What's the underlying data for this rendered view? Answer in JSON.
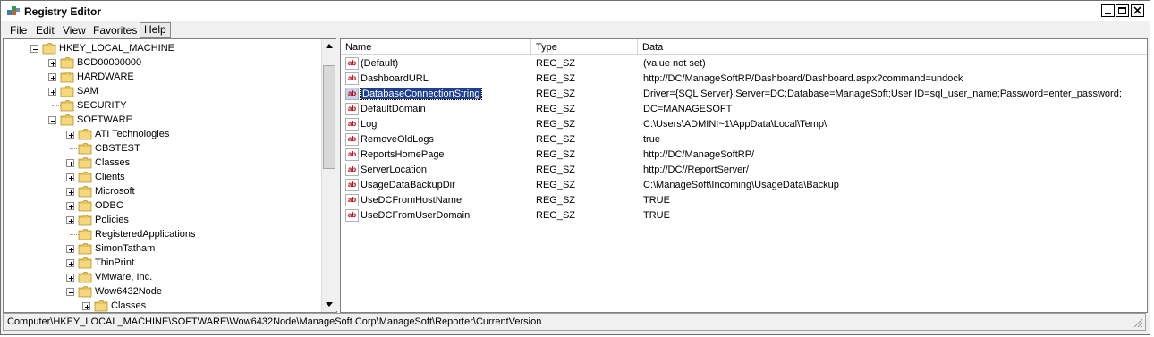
{
  "window": {
    "title": "Registry Editor"
  },
  "menu": [
    "File",
    "Edit",
    "View",
    "Favorites",
    "Help"
  ],
  "tree": [
    {
      "label": "HKEY_LOCAL_MACHINE",
      "expander": "minus"
    },
    {
      "label": "BCD00000000",
      "expander": "plus"
    },
    {
      "label": "HARDWARE",
      "expander": "plus"
    },
    {
      "label": "SAM",
      "expander": "plus"
    },
    {
      "label": "SECURITY",
      "expander": "none"
    },
    {
      "label": "SOFTWARE",
      "expander": "minus"
    },
    {
      "label": "ATI Technologies",
      "expander": "plus"
    },
    {
      "label": "CBSTEST",
      "expander": "none"
    },
    {
      "label": "Classes",
      "expander": "plus"
    },
    {
      "label": "Clients",
      "expander": "plus"
    },
    {
      "label": "Microsoft",
      "expander": "plus"
    },
    {
      "label": "ODBC",
      "expander": "plus"
    },
    {
      "label": "Policies",
      "expander": "plus"
    },
    {
      "label": "RegisteredApplications",
      "expander": "none"
    },
    {
      "label": "SimonTatham",
      "expander": "plus"
    },
    {
      "label": "ThinPrint",
      "expander": "plus"
    },
    {
      "label": "VMware, Inc.",
      "expander": "plus"
    },
    {
      "label": "Wow6432Node",
      "expander": "minus"
    },
    {
      "label": "Classes",
      "expander": "plus"
    }
  ],
  "columns": {
    "name": "Name",
    "type": "Type",
    "data": "Data"
  },
  "values": [
    {
      "icon": "string-value-icon",
      "name": "(Default)",
      "type": "REG_SZ",
      "data": "(value not set)"
    },
    {
      "icon": "string-value-icon",
      "name": "DashboardURL",
      "type": "REG_SZ",
      "data": "http://DC/ManageSoftRP/Dashboard/Dashboard.aspx?command=undock"
    },
    {
      "icon": "string-value-icon",
      "name": "DatabaseConnectionString",
      "type": "REG_SZ",
      "data": "Driver={SQL Server};Server=DC;Database=ManageSoft;User ID=sql_user_name;Password=enter_password;"
    },
    {
      "icon": "string-value-icon",
      "name": "DefaultDomain",
      "type": "REG_SZ",
      "data": "DC=MANAGESOFT"
    },
    {
      "icon": "string-value-icon",
      "name": "Log",
      "type": "REG_SZ",
      "data": "C:\\Users\\ADMINI~1\\AppData\\Local\\Temp\\"
    },
    {
      "icon": "string-value-icon",
      "name": "RemoveOldLogs",
      "type": "REG_SZ",
      "data": "true"
    },
    {
      "icon": "string-value-icon",
      "name": "ReportsHomePage",
      "type": "REG_SZ",
      "data": "http://DC/ManageSoftRP/"
    },
    {
      "icon": "string-value-icon",
      "name": "ServerLocation",
      "type": "REG_SZ",
      "data": "http://DC//ReportServer/"
    },
    {
      "icon": "string-value-icon",
      "name": "UsageDataBackupDir",
      "type": "REG_SZ",
      "data": "C:\\ManageSoft\\Incoming\\UsageData\\Backup"
    },
    {
      "icon": "string-value-icon",
      "name": "UseDCFromHostName",
      "type": "REG_SZ",
      "data": "TRUE"
    },
    {
      "icon": "string-value-icon",
      "name": "UseDCFromUserDomain",
      "type": "REG_SZ",
      "data": "TRUE"
    }
  ],
  "selected_value": "DatabaseConnectionString",
  "status": {
    "path": "Computer\\HKEY_LOCAL_MACHINE\\SOFTWARE\\Wow6432Node\\ManageSoft Corp\\ManageSoft\\Reporter\\CurrentVersion"
  },
  "colors": {
    "selection": "#1f3f8f",
    "folder": "#e8c35a",
    "icon_red": "#c0000c"
  }
}
